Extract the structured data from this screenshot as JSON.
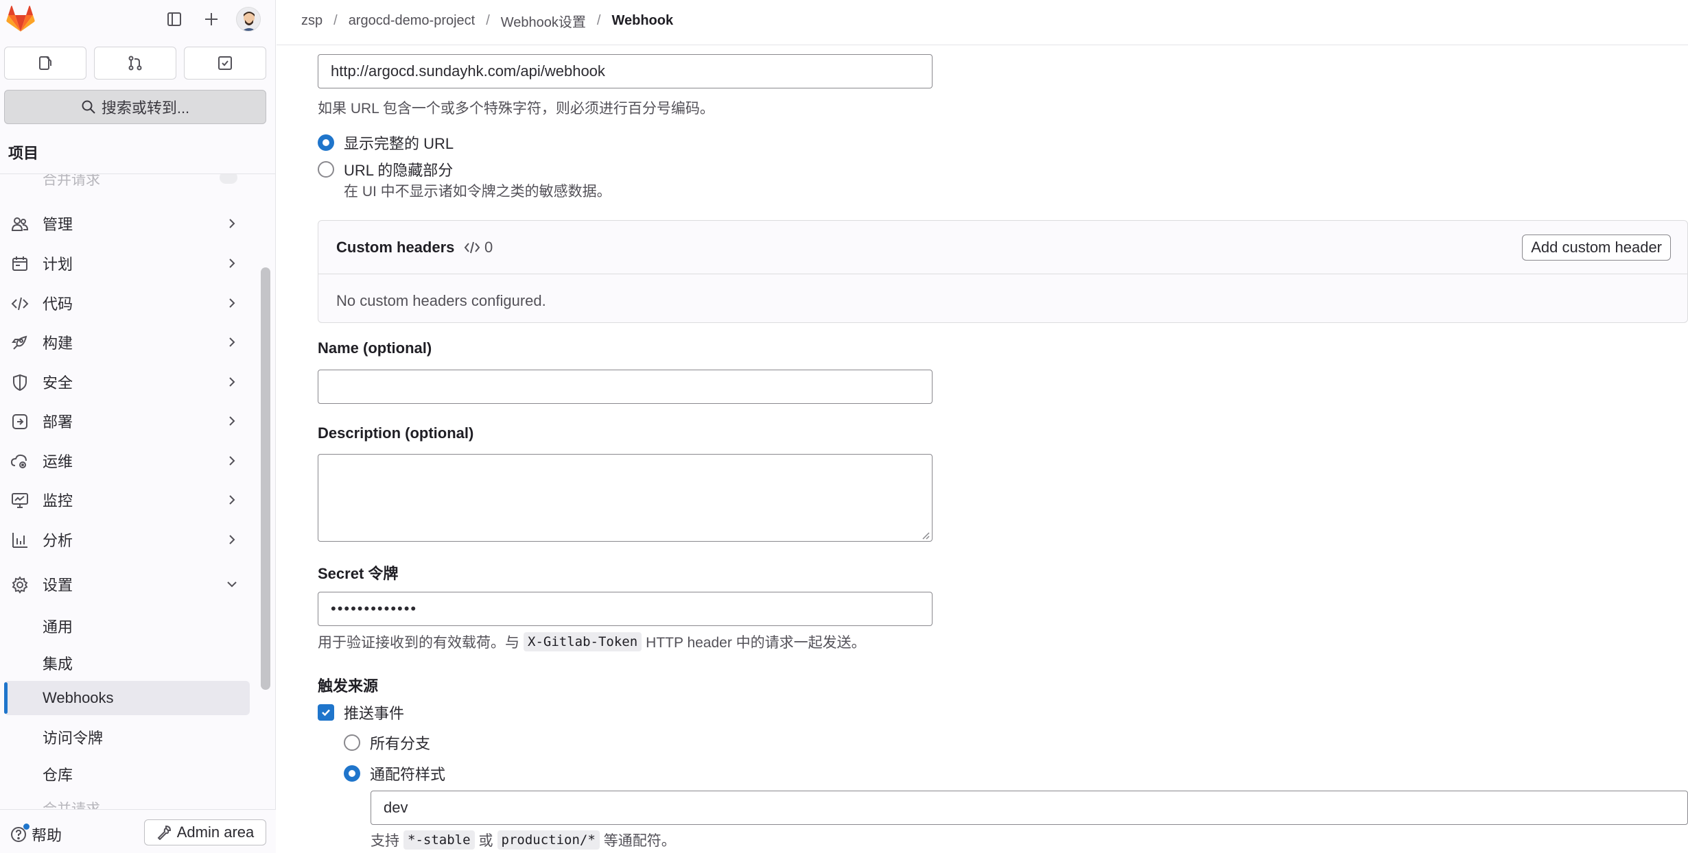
{
  "breadcrumb": [
    "zsp",
    "argocd-demo-project",
    "Webhook设置",
    "Webhook"
  ],
  "sidebar": {
    "search_label": "搜索或转到...",
    "section_label": "项目",
    "faded_top_item": "合并请求",
    "items": [
      {
        "label": "管理",
        "icon": "members-icon"
      },
      {
        "label": "计划",
        "icon": "calendar-icon"
      },
      {
        "label": "代码",
        "icon": "code-icon"
      },
      {
        "label": "构建",
        "icon": "rocket-icon"
      },
      {
        "label": "安全",
        "icon": "shield-icon"
      },
      {
        "label": "部署",
        "icon": "deploy-icon"
      },
      {
        "label": "运维",
        "icon": "cloud-gear-icon"
      },
      {
        "label": "监控",
        "icon": "monitor-icon"
      },
      {
        "label": "分析",
        "icon": "chart-icon"
      },
      {
        "label": "设置",
        "icon": "gear-icon"
      }
    ],
    "settings_subitems": [
      "通用",
      "集成",
      "Webhooks",
      "访问令牌",
      "仓库"
    ],
    "active_subitem": "Webhooks",
    "faded_bottom_item": "合并请求",
    "help_label": "帮助",
    "admin_label": "Admin area"
  },
  "form": {
    "url_value": "http://argocd.sundayhk.com/api/webhook",
    "url_help": "如果 URL 包含一个或多个特殊字符，则必须进行百分号编码。",
    "url_option_full": "显示完整的 URL",
    "url_option_masked": "URL 的隐藏部分",
    "url_option_masked_help": "在 UI 中不显示诸如令牌之类的敏感数据。",
    "custom_headers": {
      "title": "Custom headers",
      "count": "0",
      "add_label": "Add custom header",
      "empty_text": "No custom headers configured."
    },
    "name_label": "Name (optional)",
    "name_value": "",
    "description_label": "Description (optional)",
    "description_value": "",
    "secret_label": "Secret 令牌",
    "secret_value": "•••••••••••••",
    "secret_help_prefix": "用于验证接收到的有效载荷。与",
    "secret_help_code": "X-Gitlab-Token",
    "secret_help_suffix": "HTTP header 中的请求一起发送。",
    "trigger_label": "触发来源",
    "push_events_label": "推送事件",
    "all_branches_label": "所有分支",
    "wildcard_label": "通配符样式",
    "wildcard_value": "dev",
    "wildcard_help_prefix": "支持",
    "wildcard_help_code1": "*-stable",
    "wildcard_help_mid": "或",
    "wildcard_help_code2": "production/*",
    "wildcard_help_suffix": "等通配符。"
  },
  "colors": {
    "accent": "#1f75cb",
    "gitlab_orange": "#e24329"
  }
}
